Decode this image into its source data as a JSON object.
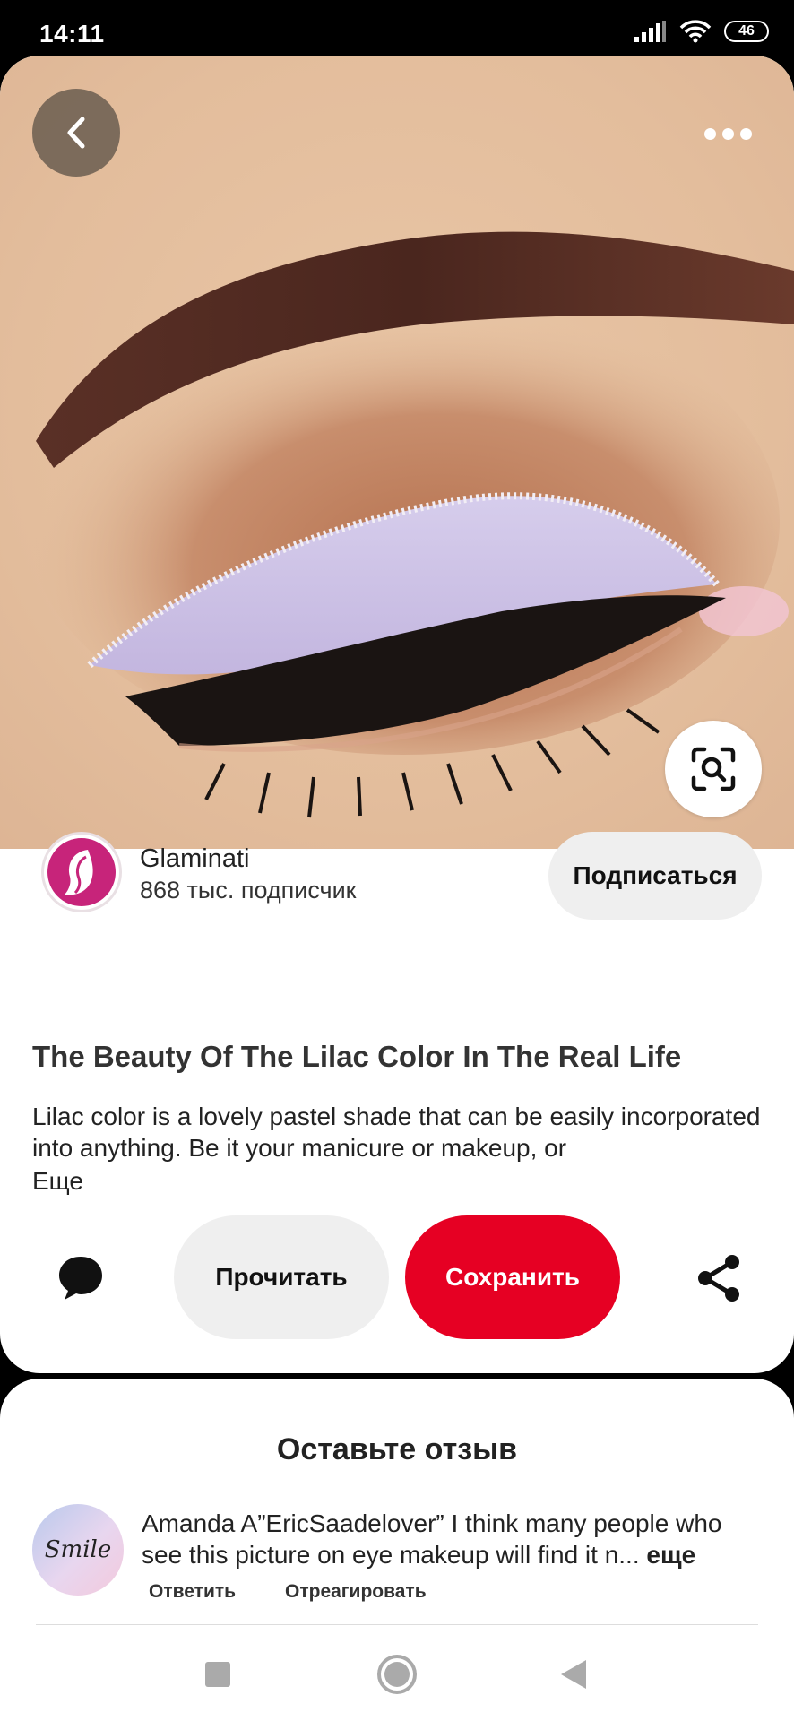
{
  "status_bar": {
    "time": "14:11",
    "battery": "46"
  },
  "pin": {
    "image_alt": "Lilac eyeshadow makeup close-up",
    "creator": {
      "name": "Glaminati",
      "followers": "868 тыс. подписчик",
      "follow_label": "Подписаться"
    },
    "title": "The Beauty Of The Lilac Color In The Real Life",
    "description": "Lilac color is a lovely pastel shade that can be easily incorporated into anything. Be it your manicure or makeup, or",
    "more_label": "Еще",
    "actions": {
      "read_label": "Прочитать",
      "save_label": "Сохранить"
    }
  },
  "comments": {
    "title": "Оставьте отзыв",
    "items": [
      {
        "avatar_text": "Smile",
        "text": "Amanda A”EricSaadelover” I think many people who see this picture on eye makeup will find it n...",
        "more_label": "еще",
        "reply_label": "Ответить",
        "react_label": "Отреагировать"
      }
    ]
  },
  "colors": {
    "save_button": "#e60023",
    "secondary_button": "#efefef",
    "lilac": "#cfc4e6"
  },
  "icons": [
    "back-arrow-icon",
    "more-dots-icon",
    "visual-search-icon",
    "comment-icon",
    "share-icon",
    "signal-icon",
    "wifi-icon",
    "battery-icon"
  ]
}
